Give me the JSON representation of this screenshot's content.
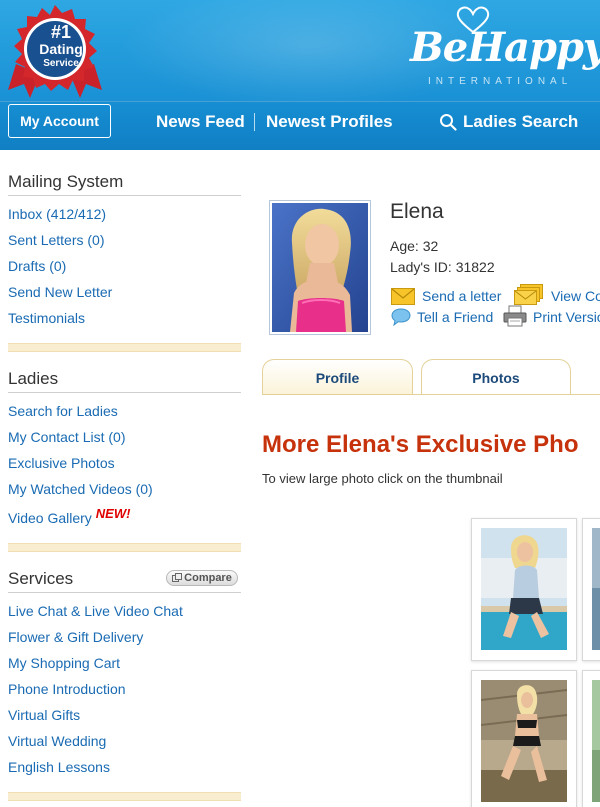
{
  "header": {
    "badge": {
      "number": "#1",
      "title": "Dating",
      "subtitle": "Service"
    },
    "logo": {
      "name": "BeHappy",
      "subtitle": "INTERNATIONAL"
    },
    "nav": {
      "my_account": "My Account",
      "news_feed": "News Feed",
      "newest_profiles": "Newest Profiles",
      "ladies_search": "Ladies Search"
    }
  },
  "sidebar": {
    "mailing": {
      "title": "Mailing System",
      "items": [
        "Inbox (412/412)",
        "Sent Letters (0)",
        "Drafts (0)",
        "Send New Letter",
        "Testimonials"
      ]
    },
    "ladies": {
      "title": "Ladies",
      "items": [
        "Search for Ladies",
        "My Contact List (0)",
        "Exclusive Photos",
        "My Watched Videos (0)",
        "Video Gallery"
      ],
      "new_tag": "NEW!"
    },
    "services": {
      "title": "Services",
      "compare": "Compare",
      "items": [
        "Live Chat & Live Video Chat",
        "Flower & Gift Delivery",
        "My Shopping Cart",
        "Phone Introduction",
        "Virtual Gifts",
        "Virtual Wedding",
        "English Lessons"
      ]
    }
  },
  "profile": {
    "name": "Elena",
    "age": "Age: 32",
    "lady_id": "Lady's ID: 31822",
    "actions": {
      "send_letter": "Send a letter",
      "view": "View Co",
      "tell_friend": "Tell a Friend",
      "print": "Print Versio"
    }
  },
  "tabs": {
    "profile": "Profile",
    "photos": "Photos"
  },
  "photos_section": {
    "title": "More Elena's Exclusive Pho",
    "hint": "To view large photo click on the thumbnail"
  },
  "colors": {
    "header_blue": "#1b93d6",
    "link_blue": "#1a6bb3",
    "title_red": "#c6320b",
    "badge_red": "#d3272c",
    "tab_text": "#1c4a7a"
  }
}
